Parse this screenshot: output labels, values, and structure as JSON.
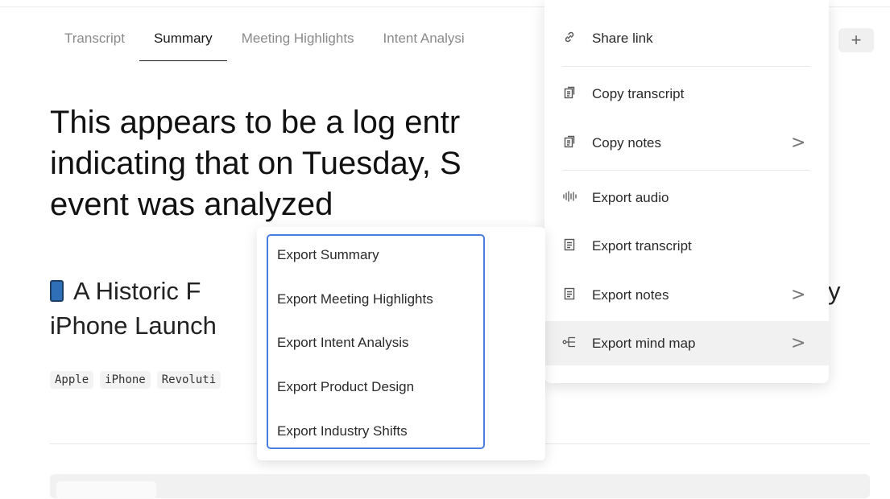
{
  "tabs": [
    "Transcript",
    "Summary",
    "Meeting Highlights",
    "Intent Analysi"
  ],
  "active_tab": "Summary",
  "add_tab_label": "+",
  "headline": {
    "line1": "This appears to be a log entr",
    "line2": "indicating that on Tuesday, S",
    "line3": "event was analyzed"
  },
  "subhead": {
    "line1": "A Historic F",
    "line1_trail": "y",
    "line2": "iPhone Launch"
  },
  "tags": [
    "Apple",
    "iPhone",
    "Revoluti"
  ],
  "menu": {
    "items": [
      {
        "label": "Share link",
        "icon": "link-icon",
        "chevron": ""
      },
      {
        "label": "Copy transcript",
        "icon": "copy-icon",
        "chevron": ""
      },
      {
        "label": "Copy notes",
        "icon": "copy-icon",
        "chevron": ">"
      },
      {
        "label": "Export audio",
        "icon": "audio-wave-icon",
        "chevron": ""
      },
      {
        "label": "Export transcript",
        "icon": "document-icon",
        "chevron": ""
      },
      {
        "label": "Export notes",
        "icon": "document-icon",
        "chevron": ">"
      },
      {
        "label": "Export mind map",
        "icon": "mind-map-icon",
        "chevron": ">"
      }
    ],
    "highlighted": "Export mind map"
  },
  "submenu": {
    "items": [
      "Export Summary",
      "Export Meeting Highlights",
      "Export Intent Analysis",
      "Export Product Design",
      "Export Industry Shifts"
    ]
  }
}
